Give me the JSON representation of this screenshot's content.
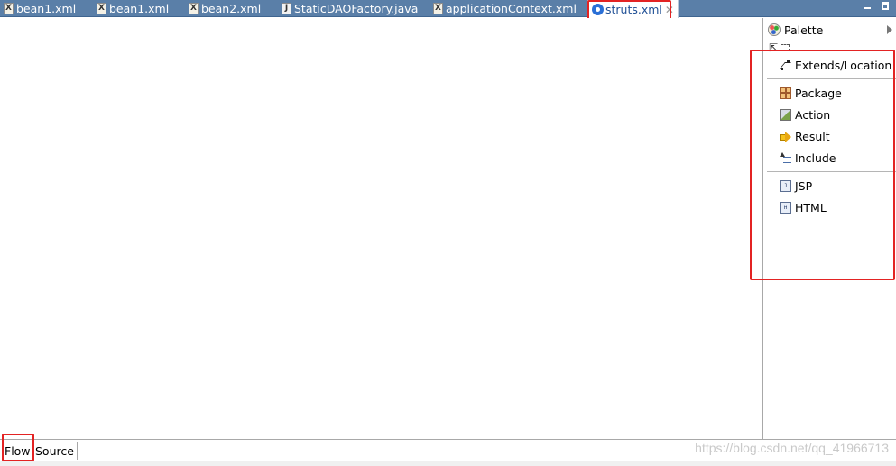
{
  "tabs": [
    {
      "label": "bean1.xml",
      "icon": "xml-file-icon"
    },
    {
      "label": "bean1.xml",
      "icon": "xml-file-icon"
    },
    {
      "label": "bean2.xml",
      "icon": "xml-file-icon"
    },
    {
      "label": "StaticDAOFactory.java",
      "icon": "java-file-icon"
    },
    {
      "label": "applicationContext.xml",
      "icon": "xml-file-icon"
    },
    {
      "label": "struts.xml",
      "icon": "struts-config-icon",
      "active": true,
      "close": "✕"
    }
  ],
  "palette": {
    "title": "Palette",
    "groups": [
      [
        {
          "label": "Extends/Location",
          "icon": "extends-location-icon"
        }
      ],
      [
        {
          "label": "Package",
          "icon": "package-icon"
        },
        {
          "label": "Action",
          "icon": "action-icon"
        },
        {
          "label": "Result",
          "icon": "result-arrow-icon"
        },
        {
          "label": "Include",
          "icon": "include-icon"
        }
      ],
      [
        {
          "label": "JSP",
          "icon": "jsp-file-icon"
        },
        {
          "label": "HTML",
          "icon": "html-file-icon"
        }
      ]
    ]
  },
  "bottom_tabs": [
    {
      "label": "Flow",
      "active": true
    },
    {
      "label": "Source",
      "active": false
    }
  ],
  "watermark": "https://blog.csdn.net/qq_41966713",
  "colors": {
    "tabbar": "#5a7fa8",
    "highlight": "#e32323"
  }
}
